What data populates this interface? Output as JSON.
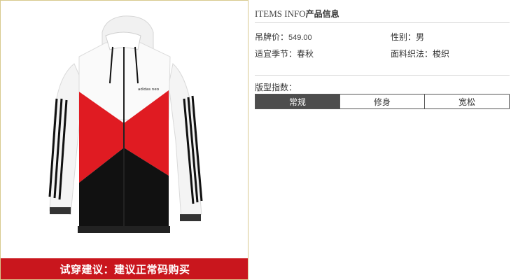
{
  "product": {
    "brand_logo": "adidas neo",
    "fit_suggestion": "试穿建议：建议正常码购买"
  },
  "info": {
    "header_en": "ITEMS INFO",
    "header_cn": "产品信息",
    "attributes": [
      {
        "key": "吊牌价：",
        "value": "549.00"
      },
      {
        "key": "性别：",
        "value": "男"
      },
      {
        "key": "适宜季节：",
        "value": "春秋"
      },
      {
        "key": "面料织法：",
        "value": "梭织"
      }
    ],
    "fit_title": "版型指数：",
    "fit_options": [
      {
        "label": "常规",
        "selected": true
      },
      {
        "label": "修身",
        "selected": false
      },
      {
        "label": "宽松",
        "selected": false
      }
    ]
  },
  "colors": {
    "red": "#e01b22",
    "black": "#111111",
    "banner": "#c9161d",
    "selected": "#4d4d4d",
    "panel_border": "#d8c98e"
  }
}
